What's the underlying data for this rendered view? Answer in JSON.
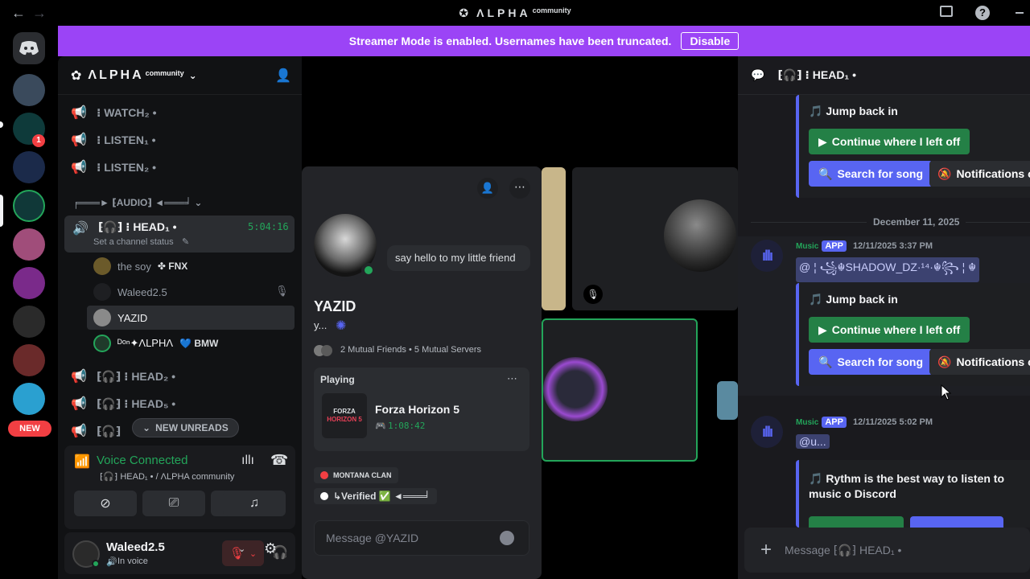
{
  "titlebar": {
    "app_name": "ΛLPHA",
    "app_suffix": "community"
  },
  "rail": {
    "new_badge": "NEW",
    "mention_count": "1"
  },
  "banner": {
    "text": "Streamer Mode is enabled. Usernames have been truncated.",
    "button": "Disable"
  },
  "sidebar": {
    "guild_name": "ΛLPHA",
    "guild_suffix": "community",
    "channels_top": [
      {
        "label": "⁝ WATCH₂ •"
      },
      {
        "label": "⁝ LISTEN₁ •"
      },
      {
        "label": "⁝ LISTEN₂ •"
      }
    ],
    "category": "╒═══► ⁅AUDIO⁆ ◄═══╛",
    "active_channel": {
      "label": "⁅🎧⁆ ⁝ HEAD₁ •",
      "timer": "5:04:16",
      "status": "Set a channel status"
    },
    "voice_users": [
      {
        "name": "the soy",
        "tag": "✤ FNX"
      },
      {
        "name": "Waleed2.5",
        "tag": ""
      },
      {
        "name": "YAZID",
        "tag": ""
      },
      {
        "name": "ᴰᵒⁿ✦ΛLPHΛ",
        "tag": "💙 BMW"
      }
    ],
    "channels_bottom": [
      {
        "label": "⁅🎧⁆ ⁝ HEAD₂ •"
      },
      {
        "label": "⁅🎧⁆ ⁝ HEAD₅ •"
      },
      {
        "label": "⁅🎧⁆"
      }
    ],
    "new_unreads": "NEW UNREADS",
    "voice": {
      "status": "Voice Connected",
      "channel": "⁅🎧⁆ HEAD₁ • / ΛLPHA community"
    },
    "user": {
      "name": "Waleed2.5",
      "status": "In voice"
    }
  },
  "popout": {
    "bubble": "say hello to my little friend",
    "name": "YAZID",
    "subname": "y...",
    "mutuals": "2 Mutual Friends • 5 Mutual Servers",
    "activity_header": "Playing",
    "game": "Forza Horizon 5",
    "game_time": "1:08:42",
    "role1": "MONTANA CLAN",
    "role2": "↳Verified ✅ ◄═══╛",
    "message_placeholder": "Message @YAZID",
    "game_logo_top": "FORZA",
    "game_logo_bottom": "HORIZON 5"
  },
  "chat": {
    "header": "⁅🎧⁆ ⁝ HEAD₁ •",
    "date_divider": "December 11, 2025",
    "messages": [
      {
        "embed_title": "🎵 Jump back in",
        "b1": "Continue where I left off",
        "b2": "Search for song",
        "b3": "Notifications of"
      },
      {
        "author": "Music",
        "app": "APP",
        "time": "12/11/2025 3:37 PM",
        "mention": "@ ¦ ꧁☬SHADOW_DZ·¹⁴·☬꧂ ¦ ☬",
        "embed_title": "🎵 Jump back in",
        "b1": "Continue where I left off",
        "b2": "Search for song",
        "b3": "Notifications of"
      },
      {
        "author": "Music",
        "app": "APP",
        "time": "12/11/2025 5:02 PM",
        "mention": "@u...",
        "embed_title": "🎵 Rythm is the best way to listen to music o Discord"
      }
    ],
    "input_placeholder": "Message ⁅🎧⁆ HEAD₁ •"
  },
  "colors": {
    "accent": "#5865f2",
    "banner": "#9b44f6",
    "green": "#23a55a"
  }
}
